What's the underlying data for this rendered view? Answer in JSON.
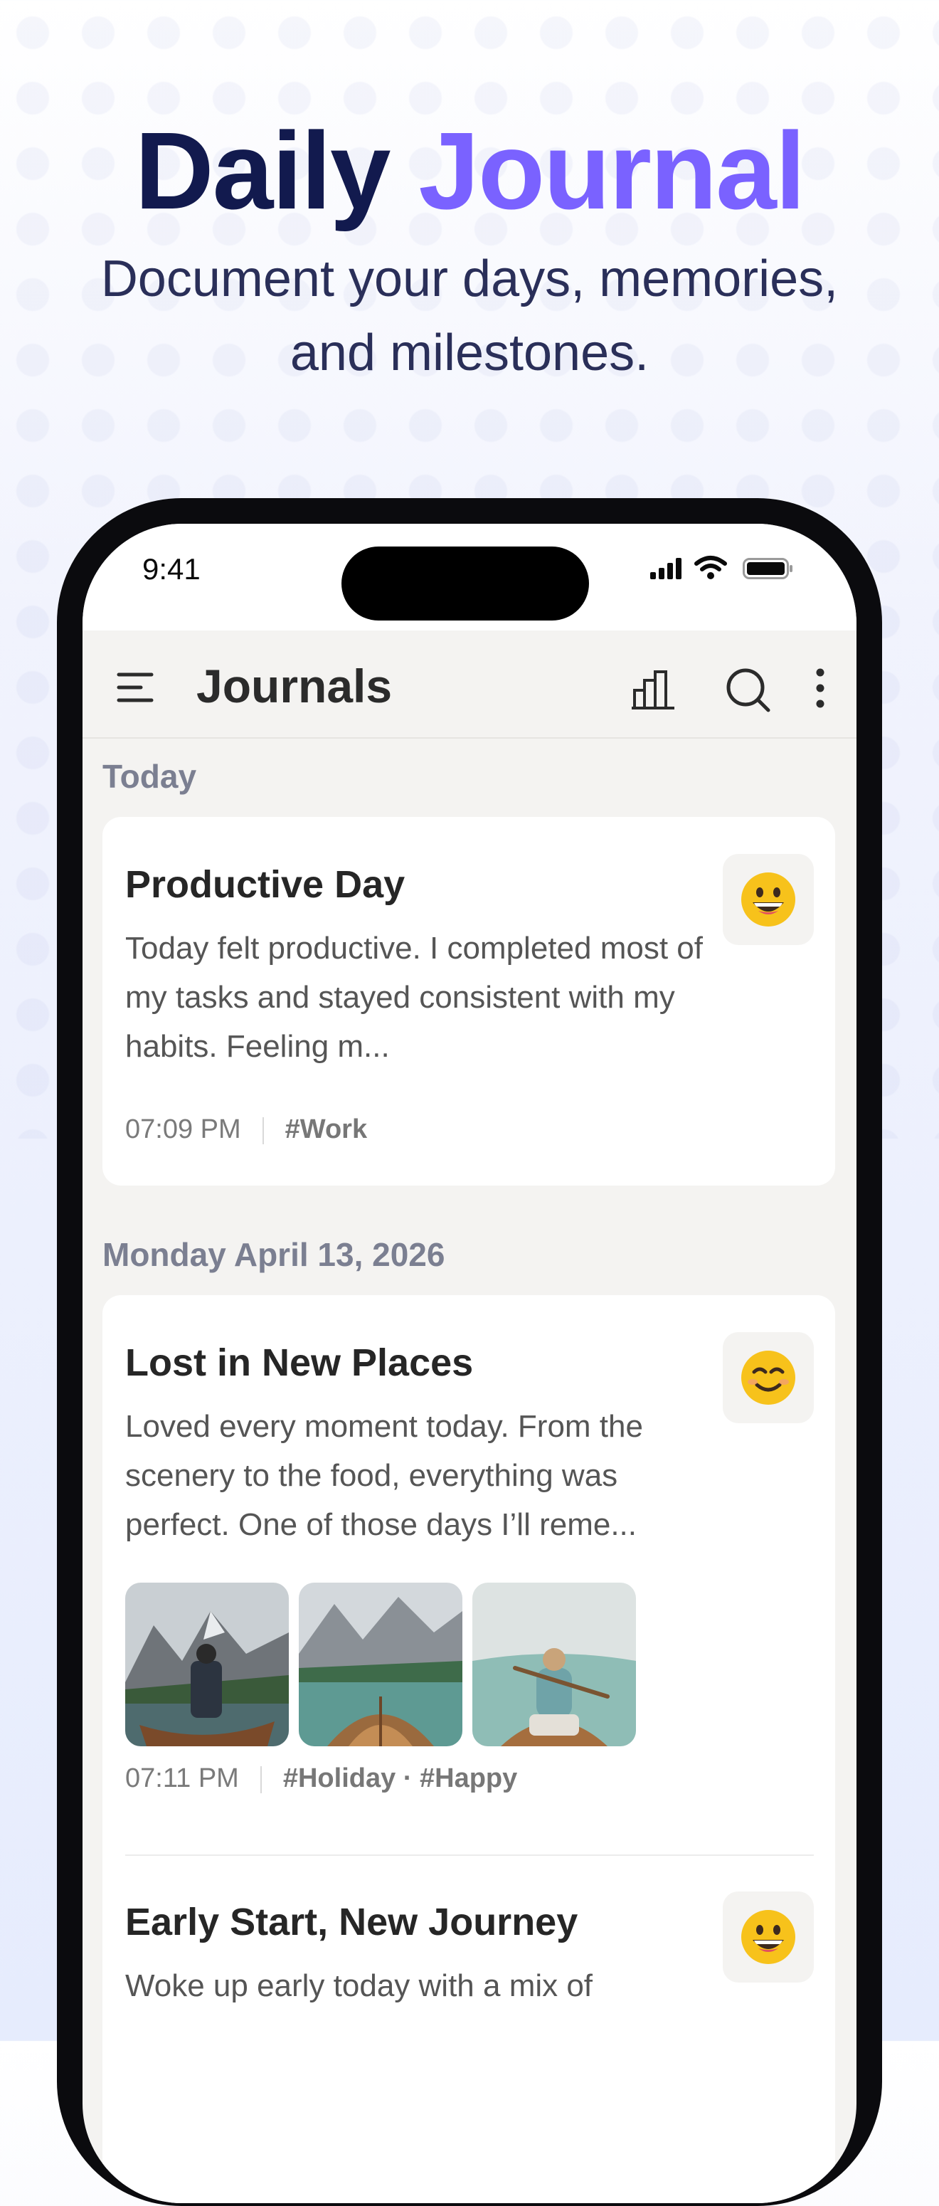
{
  "hero": {
    "title_part1": "Daily",
    "title_part2": "Journal",
    "subtitle_line1": "Document your days, memories,",
    "subtitle_line2": "and milestones."
  },
  "status_bar": {
    "time": "9:41"
  },
  "app_bar": {
    "title": "Journals",
    "icons": [
      "menu-icon",
      "chart-icon",
      "search-icon",
      "more-icon"
    ]
  },
  "sections": [
    {
      "label": "Today",
      "entries": [
        {
          "title": "Productive Day",
          "body": "Today felt productive. I completed most of my tasks and stayed consistent with my habits. Feeling m...",
          "time": "07:09 PM",
          "tags": "#Work",
          "mood": "grinning-face-icon"
        }
      ]
    },
    {
      "label": "Monday April 13, 2026",
      "entries": [
        {
          "title": "Lost in New Places",
          "body": "Loved every moment today. From the scenery to the food, everything was perfect. One of those days I’ll reme...",
          "time": "07:11 PM",
          "tags": "#Holiday · #Happy",
          "mood": "smiling-face-icon",
          "photos": [
            "lake-hiker-photo",
            "boat-lake-photo",
            "canoe-woman-photo"
          ]
        },
        {
          "title": "Early Start, New Journey",
          "body": "Woke up early today with a mix of",
          "mood": "grinning-face-icon"
        }
      ]
    }
  ],
  "colors": {
    "title_dark": "#121a4e",
    "title_accent": "#7a62ff",
    "section_label": "#7b7f91",
    "screen_bg": "#f4f3f1",
    "card_bg": "#ffffff"
  }
}
